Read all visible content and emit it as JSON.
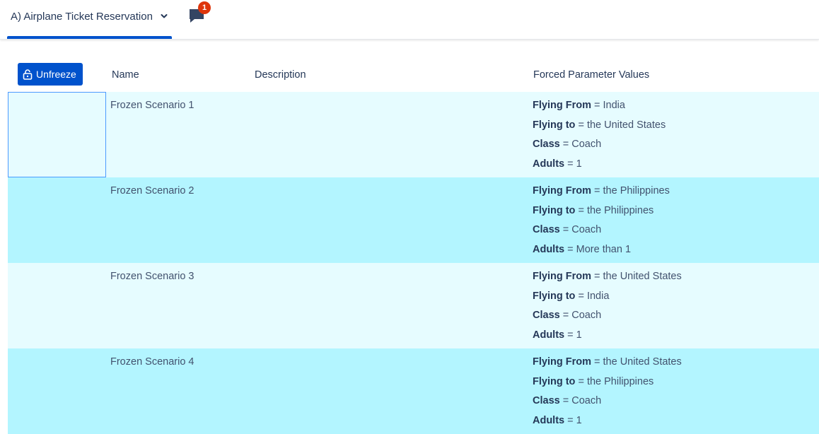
{
  "header": {
    "tab_label": "A) Airplane Ticket Reservation",
    "comment_badge": "1"
  },
  "toolbar": {
    "unfreeze_label": "Unfreeze"
  },
  "columns": {
    "name": "Name",
    "description": "Description",
    "forced": "Forced Parameter Values"
  },
  "rows": [
    {
      "name": "Frozen Scenario 1",
      "description": "",
      "params": [
        {
          "name": "Flying From",
          "sep": "=",
          "value": "India"
        },
        {
          "name": "Flying to",
          "sep": "=",
          "value": "the United States"
        },
        {
          "name": "Class",
          "sep": "=",
          "value": "Coach"
        },
        {
          "name": "Adults",
          "sep": "=",
          "value": "1"
        }
      ]
    },
    {
      "name": "Frozen Scenario 2",
      "description": "",
      "params": [
        {
          "name": "Flying From",
          "sep": "=",
          "value": "the Philippines"
        },
        {
          "name": "Flying to",
          "sep": "=",
          "value": "the Philippines"
        },
        {
          "name": "Class",
          "sep": "=",
          "value": "Coach"
        },
        {
          "name": "Adults",
          "sep": "=",
          "value": "More than 1"
        }
      ]
    },
    {
      "name": "Frozen Scenario 3",
      "description": "",
      "params": [
        {
          "name": "Flying From",
          "sep": "=",
          "value": "the United States"
        },
        {
          "name": "Flying to",
          "sep": "=",
          "value": "India"
        },
        {
          "name": "Class",
          "sep": "=",
          "value": "Coach"
        },
        {
          "name": "Adults",
          "sep": "=",
          "value": "1"
        }
      ]
    },
    {
      "name": "Frozen Scenario 4",
      "description": "",
      "params": [
        {
          "name": "Flying From",
          "sep": "=",
          "value": "the United States"
        },
        {
          "name": "Flying to",
          "sep": "=",
          "value": "the Philippines"
        },
        {
          "name": "Class",
          "sep": "=",
          "value": "Coach"
        },
        {
          "name": "Adults",
          "sep": "=",
          "value": "1"
        }
      ]
    }
  ],
  "colors": {
    "accent": "#0052cc",
    "row_light": "#e6fcff",
    "row_dark": "#b3f5ff",
    "badge": "#de350b"
  },
  "icons": {
    "chevron": "chevron-down-icon",
    "comment": "comment-icon",
    "unlock": "unlock-icon"
  }
}
